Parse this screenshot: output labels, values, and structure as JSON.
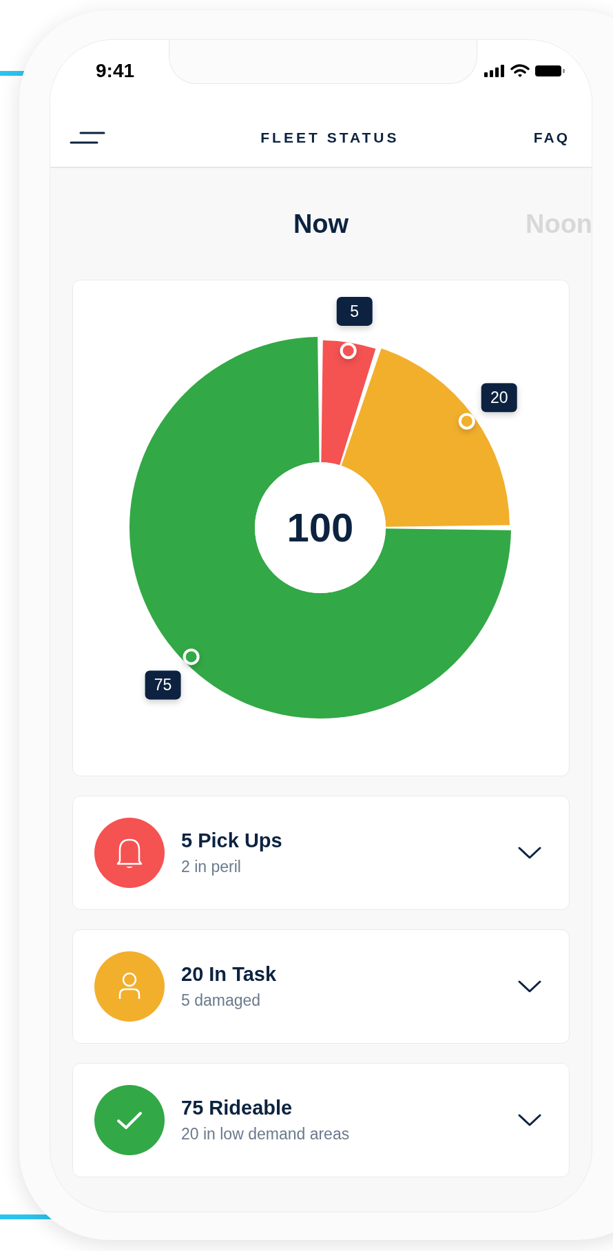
{
  "status_bar": {
    "time": "9:41"
  },
  "nav": {
    "title": "FLEET STATUS",
    "action": "FAQ"
  },
  "periods": [
    {
      "label": "Now",
      "selected": true
    },
    {
      "label": "Noon",
      "selected": false
    }
  ],
  "chart": {
    "total": "100",
    "chart_data": {
      "type": "donut",
      "data_labels": true,
      "values": [
        5,
        20,
        75
      ],
      "colors": [
        "#f55252",
        "#f2af2c",
        "#33a846"
      ]
    }
  },
  "groups": [
    {
      "kind": "bell",
      "color": "#f55252",
      "title": "5 Pick Ups",
      "subtitle": "2 in peril"
    },
    {
      "kind": "person",
      "color": "#f2af2c",
      "title": "20 In Task",
      "subtitle": "5 damaged"
    },
    {
      "kind": "check",
      "color": "#33a846",
      "title": "75 Rideable",
      "subtitle": "20 in low demand areas"
    }
  ]
}
